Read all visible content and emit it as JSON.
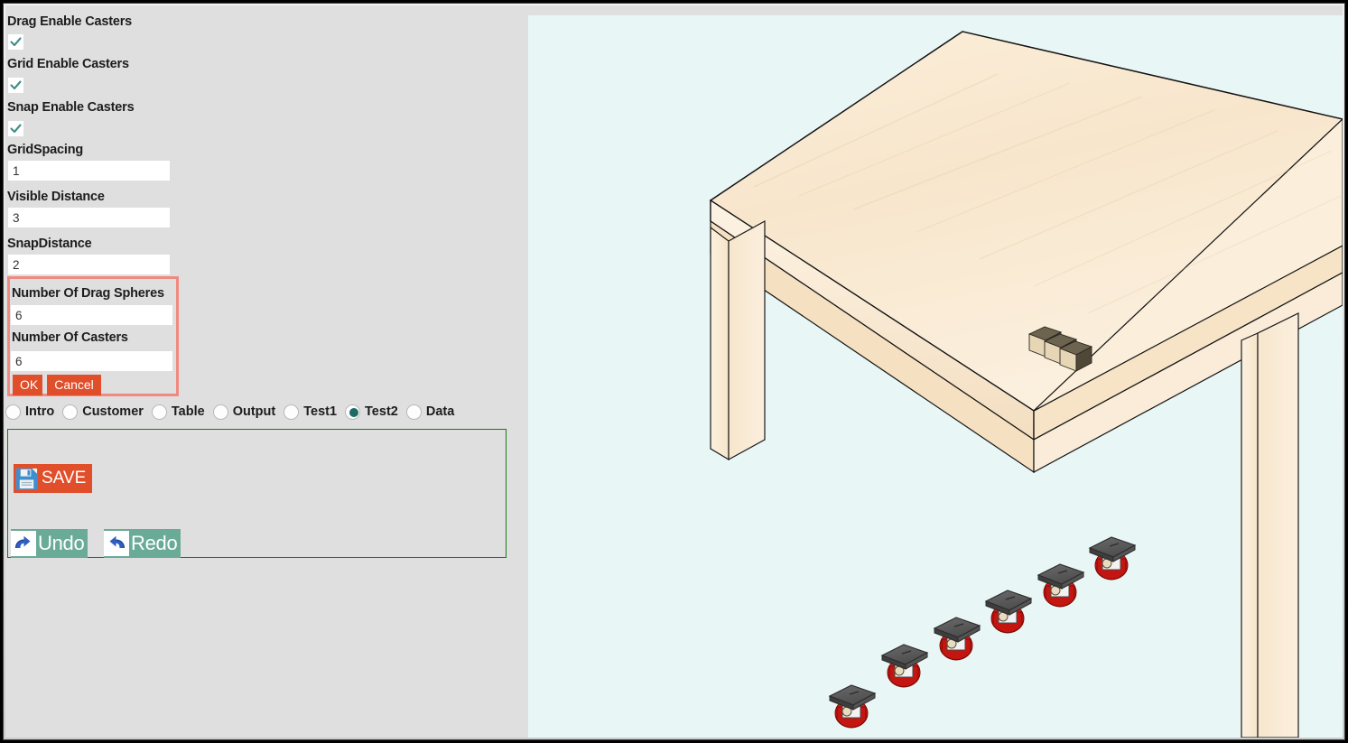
{
  "window": {
    "background": "#dfdfdf",
    "frame_color": "#3a3a3a"
  },
  "properties": [
    {
      "label": "Drag Enable Casters",
      "type": "checkbox",
      "value": "checked"
    },
    {
      "label": "Grid Enable Casters",
      "type": "checkbox",
      "value": "checked"
    },
    {
      "label": "Snap Enable Casters",
      "type": "checkbox",
      "value": "checked"
    },
    {
      "label": "GridSpacing",
      "type": "text",
      "value": "1"
    },
    {
      "label": "Visible Distance",
      "type": "text",
      "value": "3"
    },
    {
      "label": "SnapDistance",
      "type": "text",
      "value": "2"
    }
  ],
  "dialog": {
    "highlight_color": "#f08a80",
    "fields": [
      {
        "label": "Number Of Drag Spheres",
        "value": "6"
      },
      {
        "label": "Number Of Casters",
        "value": "6"
      }
    ],
    "ok_label": "OK",
    "cancel_label": "Cancel",
    "button_color": "#e04e2a"
  },
  "tabs": {
    "selected": "Test2",
    "selected_color": "#1e6b63",
    "items": [
      {
        "label": "Intro",
        "selected": false
      },
      {
        "label": "Customer",
        "selected": false
      },
      {
        "label": "Table",
        "selected": false
      },
      {
        "label": "Output",
        "selected": false
      },
      {
        "label": "Test1",
        "selected": false
      },
      {
        "label": "Test2",
        "selected": true
      },
      {
        "label": "Data",
        "selected": false
      }
    ]
  },
  "actions": {
    "border_color": "#1a7a1a",
    "save_label": "SAVE",
    "save_color": "#e04e2a",
    "undo_label": "Undo",
    "redo_label": "Redo",
    "undo_redo_color": "#6aab97"
  },
  "viewport": {
    "background": "#e9f6f6",
    "scene": {
      "table": {
        "wood_top": "#f8e7cf",
        "wood_side": "#f0dcc0",
        "edge_color": "#111111"
      },
      "blocks_on_table": 3,
      "block_color": "#5d5442",
      "casters": {
        "count": 6,
        "plate_color": "#5a5a5a",
        "wheel_color": "#e01b14",
        "hub_color": "#e8dcc0"
      }
    }
  }
}
